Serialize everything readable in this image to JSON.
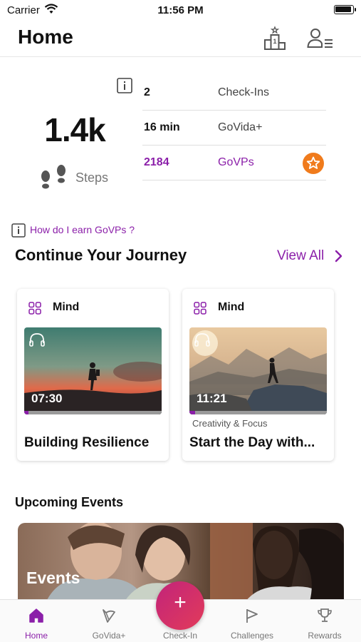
{
  "status_bar": {
    "carrier": "Carrier",
    "time": "11:56 PM"
  },
  "header": {
    "title": "Home",
    "icons": [
      "leaderboard-podium-icon",
      "profile-menu-icon"
    ]
  },
  "stats": {
    "steps_value": "1.4k",
    "steps_label": "Steps",
    "rows": [
      {
        "value": "2",
        "label": "Check-Ins"
      },
      {
        "value": "16 min",
        "label": "GoVida+"
      },
      {
        "value": "2184",
        "label": "GoVPs"
      }
    ]
  },
  "earn_link": "How do I earn GoVPs ?",
  "journey": {
    "title": "Continue Your Journey",
    "view_all": "View All",
    "cards": [
      {
        "category": "Mind",
        "duration": "07:30",
        "subcategory": "",
        "title": "Building Resilience",
        "progress": 0.03
      },
      {
        "category": "Mind",
        "duration": "11:21",
        "subcategory": "Creativity & Focus",
        "title": "Start the Day with...",
        "progress": 0.04
      }
    ]
  },
  "events": {
    "title": "Upcoming Events",
    "banner_label": "Events"
  },
  "tabbar": {
    "tabs": [
      {
        "label": "Home",
        "active": true
      },
      {
        "label": "GoVida+",
        "active": false
      },
      {
        "label": "Check-In",
        "active": false
      },
      {
        "label": "Challenges",
        "active": false
      },
      {
        "label": "Rewards",
        "active": false
      }
    ],
    "fab_symbol": "+"
  },
  "colors": {
    "accent": "#8b1fa9",
    "orange_badge": "#f07b1c",
    "fab_start": "#c2247a",
    "fab_end": "#e23b5a"
  }
}
